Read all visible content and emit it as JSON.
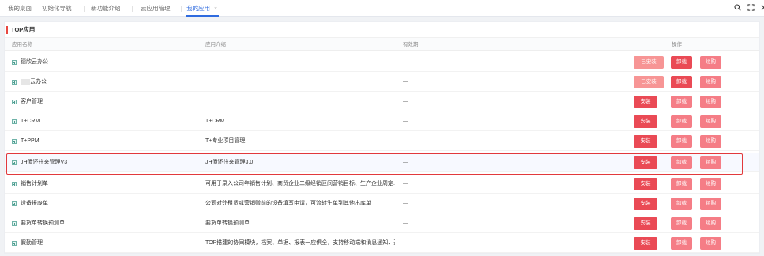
{
  "tabs": [
    {
      "label": "我的桌面"
    },
    {
      "label": "初始化导航"
    },
    {
      "label": "新功能介绍"
    },
    {
      "label": "云应用管理"
    },
    {
      "label": "我的应用",
      "close": "×"
    }
  ],
  "toolbar": {
    "search_icon": "search-icon",
    "fullscreen_icon": "fullscreen-icon",
    "more_icon": "chevron-right-icon"
  },
  "section": {
    "title": "TOP应用"
  },
  "columns": {
    "name": "应用名称",
    "intro": "应用介绍",
    "validity": "有效期",
    "actions": "操作"
  },
  "colors": {
    "accent": "#2f6bdf",
    "section_bar": "#e8473f",
    "installed": "#f79595",
    "action_strong": "#ea4a55",
    "action_light": "#f57d86",
    "highlight": "#e2393c"
  },
  "rows": [
    {
      "name": "德欣云办公",
      "intro": "",
      "validity": "—",
      "actions": [
        "已安装",
        "卸载",
        "续购"
      ]
    },
    {
      "name": "云办公",
      "intro": "",
      "validity": "—",
      "actions": [
        "已安装",
        "卸载",
        "续购"
      ]
    },
    {
      "name": "客户管理",
      "intro": "",
      "validity": "—",
      "actions": [
        "安装",
        "卸载",
        "续购"
      ]
    },
    {
      "name": "T+CRM",
      "intro": "T+CRM",
      "validity": "—",
      "actions": [
        "安装",
        "卸载",
        "续购"
      ]
    },
    {
      "name": "T+PPM",
      "intro": "T+专业项目管理",
      "validity": "—",
      "actions": [
        "安装",
        "卸载",
        "续购"
      ]
    },
    {
      "name": "JH債还往来管理V3",
      "intro": "JH債还往来管理3.0",
      "validity": "—",
      "actions": [
        "安装",
        "卸载",
        "续购"
      ]
    },
    {
      "name": "销售计划单",
      "intro": "可用于录入公司年销售计划、商贸企业二级经销区间营销目标、生产企业周定...",
      "validity": "—",
      "actions": [
        "安装",
        "卸载",
        "续购"
      ]
    },
    {
      "name": "设备报废单",
      "intro": "公司对外租赁或营销赠前的设备填写申请，可流转生单到其他出库单",
      "validity": "—",
      "actions": [
        "安装",
        "卸载",
        "续购"
      ]
    },
    {
      "name": "要货单转换预测单",
      "intro": "要货单转换预测单",
      "validity": "—",
      "actions": [
        "安装",
        "卸载",
        "续购"
      ]
    },
    {
      "name": "假勤管理",
      "intro": "TOP搭建的协同模块，档案、单据、报表一应俱全，支持移动端和消息通知、开...",
      "validity": "—",
      "actions": [
        "安装",
        "卸载",
        "续购"
      ]
    }
  ]
}
